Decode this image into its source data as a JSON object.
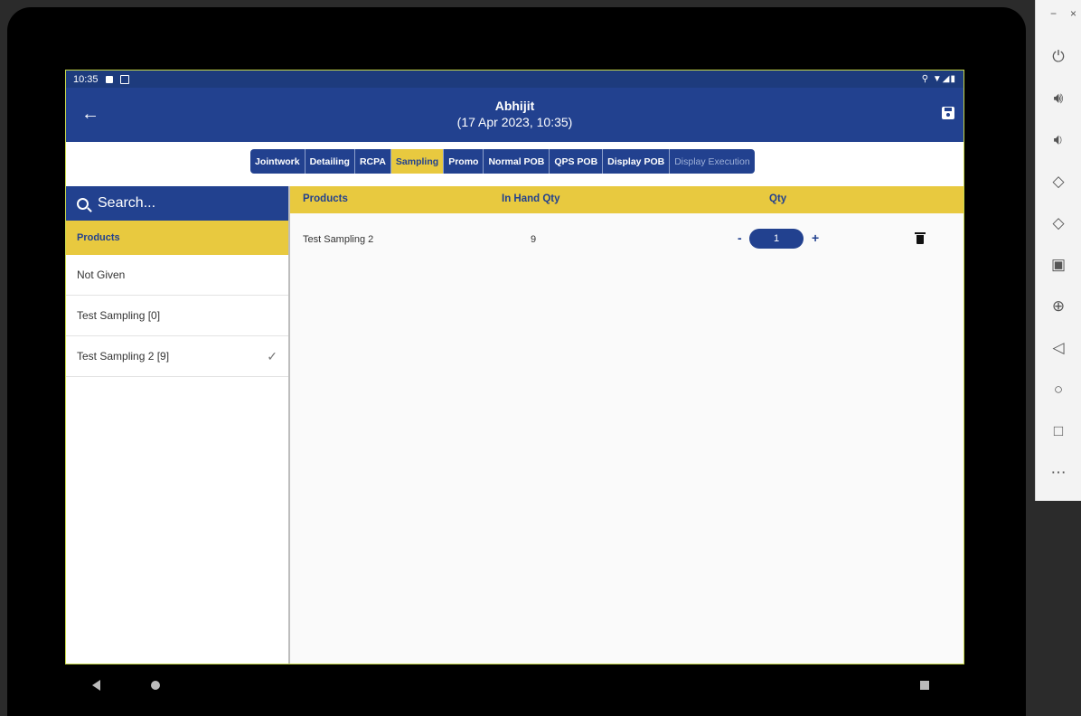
{
  "status_bar": {
    "time": "10:35",
    "right_icons": "⚲ ▼◢▮"
  },
  "app_bar": {
    "title": "Abhijit",
    "subtitle": "(17 Apr 2023, 10:35)",
    "back_icon": "arrow-left",
    "save_icon": "save"
  },
  "tabs": [
    {
      "label": "Jointwork",
      "state": "normal"
    },
    {
      "label": "Detailing",
      "state": "normal"
    },
    {
      "label": "RCPA",
      "state": "normal"
    },
    {
      "label": "Sampling",
      "state": "active"
    },
    {
      "label": "Promo",
      "state": "normal"
    },
    {
      "label": "Normal POB",
      "state": "normal"
    },
    {
      "label": "QPS POB",
      "state": "normal"
    },
    {
      "label": "Display POB",
      "state": "normal"
    },
    {
      "label": "Display Execution",
      "state": "disabled"
    }
  ],
  "sidebar_list": {
    "search_placeholder": "Search...",
    "header": "Products",
    "items": [
      {
        "label": "Not Given",
        "checked": false
      },
      {
        "label": "Test Sampling  [0]",
        "checked": false
      },
      {
        "label": "Test Sampling 2 [9]",
        "checked": true
      }
    ]
  },
  "table": {
    "headers": {
      "products": "Products",
      "in_hand": "In Hand Qty",
      "qty": "Qty"
    },
    "rows": [
      {
        "product": "Test Sampling 2",
        "in_hand": "9",
        "qty": "1"
      }
    ],
    "minus": "-",
    "plus": "+"
  },
  "emulator_toolbar": {
    "window_controls": [
      "−",
      "×"
    ],
    "tools": [
      "power-icon",
      "volume-up-icon",
      "volume-down-icon",
      "rotate-left-icon",
      "rotate-right-icon",
      "camera-icon",
      "zoom-icon",
      "back-icon",
      "home-icon",
      "overview-icon",
      "more-icon"
    ]
  },
  "colors": {
    "primary": "#22418f",
    "accent": "#e8c93f",
    "status_bar": "#1d3b7d"
  }
}
